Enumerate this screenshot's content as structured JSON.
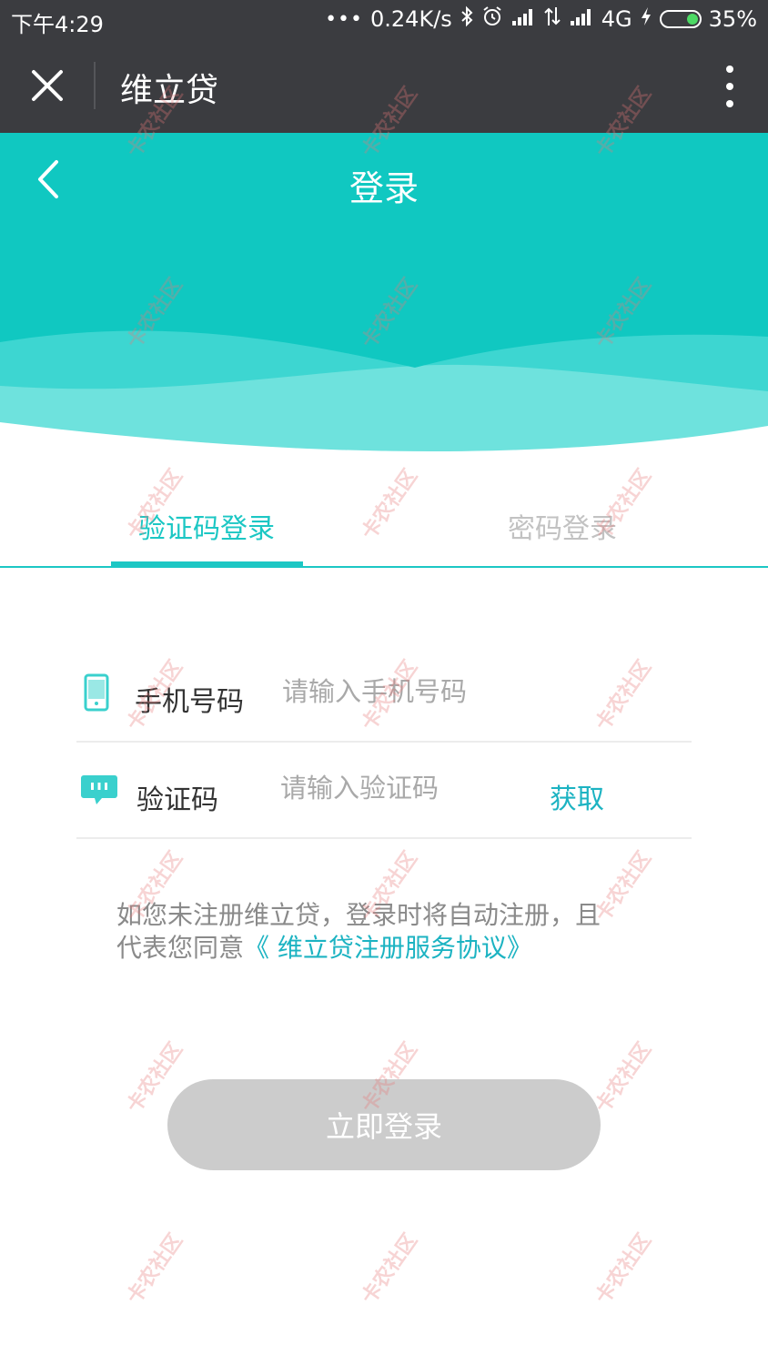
{
  "status_bar": {
    "time": "下午4:29",
    "network_speed": "0.24K/s",
    "network_type": "4G",
    "battery": "35%",
    "icons": [
      "more-dots-icon",
      "bluetooth-icon",
      "alarm-icon",
      "signal-icon",
      "data-arrows-icon",
      "signal-icon",
      "charging-icon",
      "battery-icon"
    ]
  },
  "header": {
    "title": "维立贷",
    "close_icon": "close-icon",
    "more_icon": "more-vertical-icon"
  },
  "banner": {
    "title": "登录",
    "back_icon": "chevron-left-icon",
    "colors": {
      "primary": "#10c8c1",
      "wave_mid": "#3dd6d1",
      "wave_light": "#6ee2dd"
    }
  },
  "tabs": [
    {
      "label": "验证码登录",
      "active": true
    },
    {
      "label": "密码登录",
      "active": false
    }
  ],
  "form": {
    "phone": {
      "label": "手机号码",
      "placeholder": "请输入手机号码",
      "icon": "phone-icon"
    },
    "code": {
      "label": "验证码",
      "placeholder": "请输入验证码",
      "icon": "message-icon",
      "action": "获取"
    }
  },
  "agreement": {
    "text_line1": "如您未注册维立贷，登录时将自动注册，且",
    "text_line2_prefix": "代表您同意",
    "link": "《 维立贷注册服务协议》"
  },
  "login_button": {
    "label": "立即登录",
    "enabled": false
  },
  "watermark": {
    "text": "卡农社区"
  },
  "accent_color": "#1cc7c4"
}
